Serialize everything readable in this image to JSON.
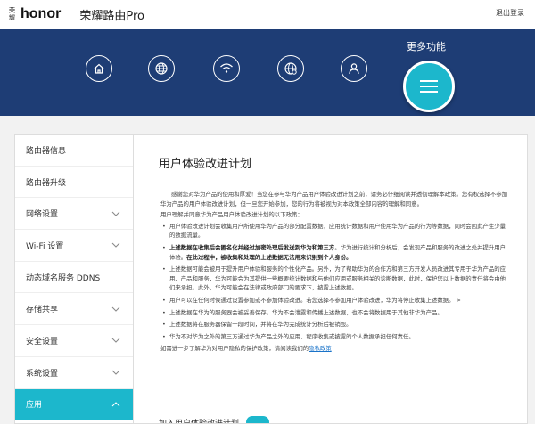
{
  "header": {
    "brand_small": "荣耀",
    "brand_logo": "honor",
    "title": "荣耀路由Pro",
    "logout": "退出登录"
  },
  "nav": {
    "more_label": "更多功能",
    "icons": [
      "home-icon",
      "globe-icon",
      "wifi-icon",
      "globe-network-icon",
      "user-icon"
    ]
  },
  "sidebar": {
    "items": [
      {
        "label": "路由器信息",
        "chevron": false
      },
      {
        "label": "路由器升级",
        "chevron": false
      },
      {
        "label": "网络设置",
        "chevron": true
      },
      {
        "label": "Wi-Fi 设置",
        "chevron": true
      },
      {
        "label": "动态域名服务 DDNS",
        "chevron": false
      },
      {
        "label": "存储共享",
        "chevron": true
      },
      {
        "label": "安全设置",
        "chevron": true
      },
      {
        "label": "系统设置",
        "chevron": true
      },
      {
        "label": "应用",
        "chevron": true,
        "active": true
      }
    ]
  },
  "main": {
    "title": "用户体验改进计划",
    "intro": "感谢您对华为产品的使用和厚爱！当您在参与华为产品用户体验改进计划之前，请务必仔细阅读并透彻理解本政策。您有权选择不参加华为产品的用户体验改进计划，但一旦您开始参加，您的行为将被视为对本政策全部内容的理解和同意。",
    "lead": "用户理解并同意华为产品用户体验改进计划的以下政策：",
    "b1_pre": "用户体验改进计划会收集用户所使用华为产品的部分配置数据，应用统计数据和用户使用华为产品的行为等数据，同时会因此产生少量的数据流量。",
    "b2_bold1": "上述数据在收集后会匿名化并经过加密处理后发送到华为和第三方",
    "b2_mid": "。华为进行统计和分析后，会发现产品和服务的改进之处并提升用户体验。",
    "b2_bold2": "在此过程中，被收集和处理的上述数据无法用来识别到个人身份。",
    "b3": "上述数据可能会被用于提升用户体验和服务的个性化产品。另外，为了帮助华为的合作方和第三方开发人员改进其专用于华为产品的应用、产品和服务，华为可能会为其提供一些概要统计数据和与他们应用或服务相关的诊断数据，此时，保护您以上数据的责任将会由他们来承担。此外，华为可能会在法律或政府部门的要求下，披露上述数据。",
    "b4": "用户可以在任何时候通过设置参加或不参加体验改进。若您选择不参加用户体验改进，华为将停止收集上述数据。 >",
    "b5": "上述数据在华为的服务器会被妥善保存。华为不会泄露和传播上述数据，也不会将数据用于其他非华为产品。",
    "b6": "上述数据将在服务器保留一段时间，并将在华为完成统计分析后被销毁。",
    "b7": "华为不对华为之外的第三方通过华为产品之外的应用、程序收集或披露的个人数据承担任何责任。",
    "footer_pre": "如需进一步了解华为对用户隐私的保护政策，请阅读我们的",
    "footer_link": "隐私政策",
    "bottom_label": "加入用户体验改进计划"
  }
}
